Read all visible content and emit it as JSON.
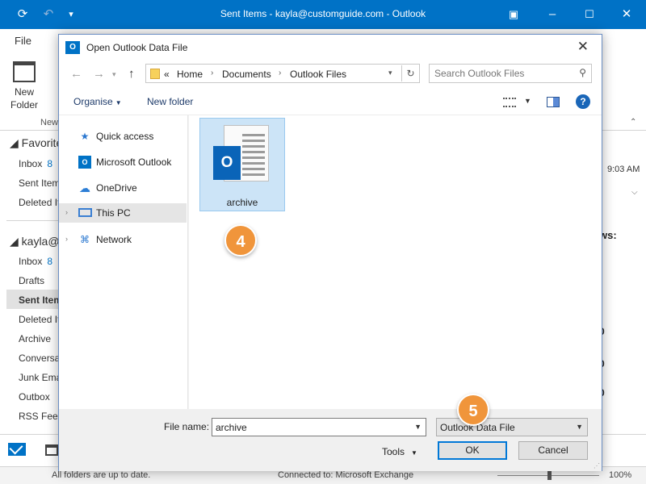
{
  "window": {
    "title": "Sent Items - kayla@customguide.com - Outlook",
    "file_tab": "File",
    "ribbon": {
      "new_folder_label": "New Folder",
      "new_group": "New"
    }
  },
  "nav_pane": {
    "favorites_head": "Favorite",
    "favorites": [
      {
        "label": "Inbox",
        "count": "8"
      },
      {
        "label": "Sent Item"
      },
      {
        "label": "Deleted It"
      }
    ],
    "account_head": "kayla@",
    "account_items": [
      {
        "label": "Inbox",
        "count": "8"
      },
      {
        "label": "Drafts"
      },
      {
        "label": "Sent Item"
      },
      {
        "label": "Deleted It"
      },
      {
        "label": "Archive"
      },
      {
        "label": "Conversa"
      },
      {
        "label": "Junk Ema"
      },
      {
        "label": "Outbox"
      },
      {
        "label": "RSS Feeds"
      }
    ]
  },
  "reading_pane": {
    "time": "9:03 AM",
    "snippet": "ws:",
    "digits": [
      "0",
      "0",
      "0"
    ]
  },
  "statusbar": {
    "left": "All folders are up to date.",
    "middle": "Connected to: Microsoft Exchange",
    "zoom": "100%"
  },
  "dialog": {
    "title": "Open Outlook Data File",
    "breadcrumb": {
      "prefix": "«",
      "items": [
        "Home",
        "Documents",
        "Outlook Files"
      ]
    },
    "search_placeholder": "Search Outlook Files",
    "toolbar": {
      "organise": "Organise",
      "new_folder": "New folder"
    },
    "nav_tree": [
      {
        "label": "Quick access",
        "icon": "star-icon"
      },
      {
        "label": "Microsoft Outlook",
        "icon": "outlook-icon"
      },
      {
        "label": "OneDrive",
        "icon": "cloud-icon"
      },
      {
        "label": "This PC",
        "icon": "computer-icon",
        "selected": true
      },
      {
        "label": "Network",
        "icon": "network-icon"
      }
    ],
    "files": [
      {
        "name": "archive",
        "selected": true
      }
    ],
    "file_name_label": "File name:",
    "file_name_value": "archive",
    "file_type": "Outlook Data File",
    "tools_label": "Tools",
    "ok_label": "OK",
    "cancel_label": "Cancel"
  },
  "steps": {
    "select_file": "4",
    "click_ok": "5"
  },
  "colors": {
    "outlook_blue": "#0072c6",
    "step_orange": "#f0953b",
    "selection": "#cce4f7"
  }
}
